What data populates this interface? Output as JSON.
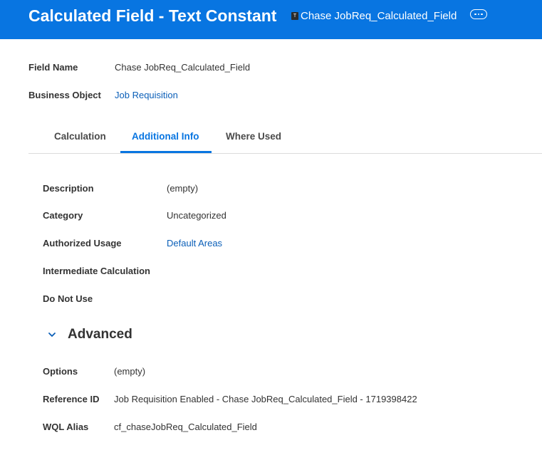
{
  "header": {
    "title": "Calculated Field - Text Constant",
    "instance_icon_letter": "T",
    "instance_name": "Chase JobReq_Calculated_Field",
    "related_actions_icon": "more-dots-icon"
  },
  "summary": {
    "field_name_label": "Field Name",
    "field_name_value": "Chase JobReq_Calculated_Field",
    "business_object_label": "Business Object",
    "business_object_value": "Job Requisition"
  },
  "tabs": [
    {
      "label": "Calculation",
      "active": false
    },
    {
      "label": "Additional Info",
      "active": true
    },
    {
      "label": "Where Used",
      "active": false
    }
  ],
  "additional_info": {
    "description_label": "Description",
    "description_value": "(empty)",
    "category_label": "Category",
    "category_value": "Uncategorized",
    "authorized_usage_label": "Authorized Usage",
    "authorized_usage_value": "Default Areas",
    "intermediate_label": "Intermediate Calculation",
    "do_not_use_label": "Do Not Use"
  },
  "advanced": {
    "title": "Advanced",
    "expanded": true,
    "options_label": "Options",
    "options_value": "(empty)",
    "reference_id_label": "Reference ID",
    "reference_id_value": "Job Requisition Enabled - Chase JobReq_Calculated_Field - 1719398422",
    "wql_alias_label": "WQL Alias",
    "wql_alias_value": "cf_chaseJobReq_Calculated_Field"
  },
  "colors": {
    "header_bg": "#0875e1",
    "link": "#0b5fb8",
    "active_tab": "#0875e1"
  }
}
